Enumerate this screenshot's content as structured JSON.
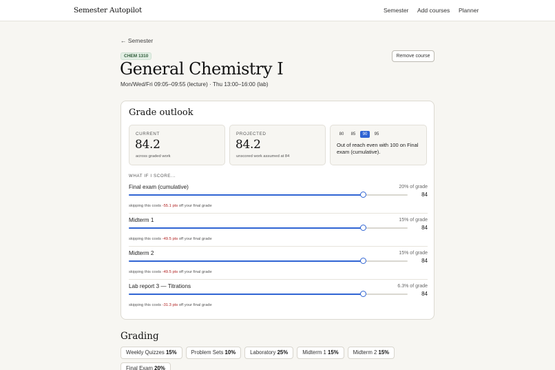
{
  "app": {
    "brand": "Semester Autopilot"
  },
  "nav": {
    "semester": "Semester",
    "add_courses": "Add courses",
    "planner": "Planner"
  },
  "course": {
    "back_label": "← Semester",
    "code": "CHEM 1310",
    "title": "General Chemistry I",
    "schedule": "Mon/Wed/Fri 09:05–09:55 (lecture) · Thu 13:00–16:00 (lab)",
    "remove_label": "Remove course"
  },
  "outlook": {
    "title": "Grade outlook",
    "current": {
      "label": "CURRENT",
      "value": "84.2",
      "sub": "across graded work"
    },
    "projected": {
      "label": "PROJECTED",
      "value": "84.2",
      "sub": "unscored work assumed at 84"
    },
    "targets": [
      {
        "label": "80",
        "active": false
      },
      {
        "label": "85",
        "active": false
      },
      {
        "label": "90",
        "active": true
      },
      {
        "label": "95",
        "active": false
      }
    ],
    "target_message": "Out of reach even with 100 on Final exam (cumulative).",
    "accent_color": "#2f64d3",
    "whatif_label": "WHAT IF I SCORE...",
    "rows": [
      {
        "name": "Final exam (cumulative)",
        "weight": "20% of grade",
        "score": "84",
        "value_fraction": 0.84,
        "cost_prefix": "skipping this costs ",
        "cost": "-55.1 pts",
        "cost_suffix": " off your final grade"
      },
      {
        "name": "Midterm 1",
        "weight": "15% of grade",
        "score": "84",
        "value_fraction": 0.84,
        "cost_prefix": "skipping this costs ",
        "cost": "-49.5 pts",
        "cost_suffix": " off your final grade"
      },
      {
        "name": "Midterm 2",
        "weight": "15% of grade",
        "score": "84",
        "value_fraction": 0.84,
        "cost_prefix": "skipping this costs ",
        "cost": "-49.5 pts",
        "cost_suffix": " off your final grade"
      },
      {
        "name": "Lab report 3 — Titrations",
        "weight": "6.3% of grade",
        "score": "84",
        "value_fraction": 0.84,
        "cost_prefix": "skipping this costs ",
        "cost": "-31.3 pts",
        "cost_suffix": " off your final grade"
      }
    ]
  },
  "grading": {
    "title": "Grading",
    "chips": [
      {
        "name": "Weekly Quizzes",
        "pct": "15%"
      },
      {
        "name": "Problem Sets",
        "pct": "10%"
      },
      {
        "name": "Laboratory",
        "pct": "25%"
      },
      {
        "name": "Midterm 1",
        "pct": "15%"
      },
      {
        "name": "Midterm 2",
        "pct": "15%"
      },
      {
        "name": "Final Exam",
        "pct": "20%"
      }
    ]
  }
}
